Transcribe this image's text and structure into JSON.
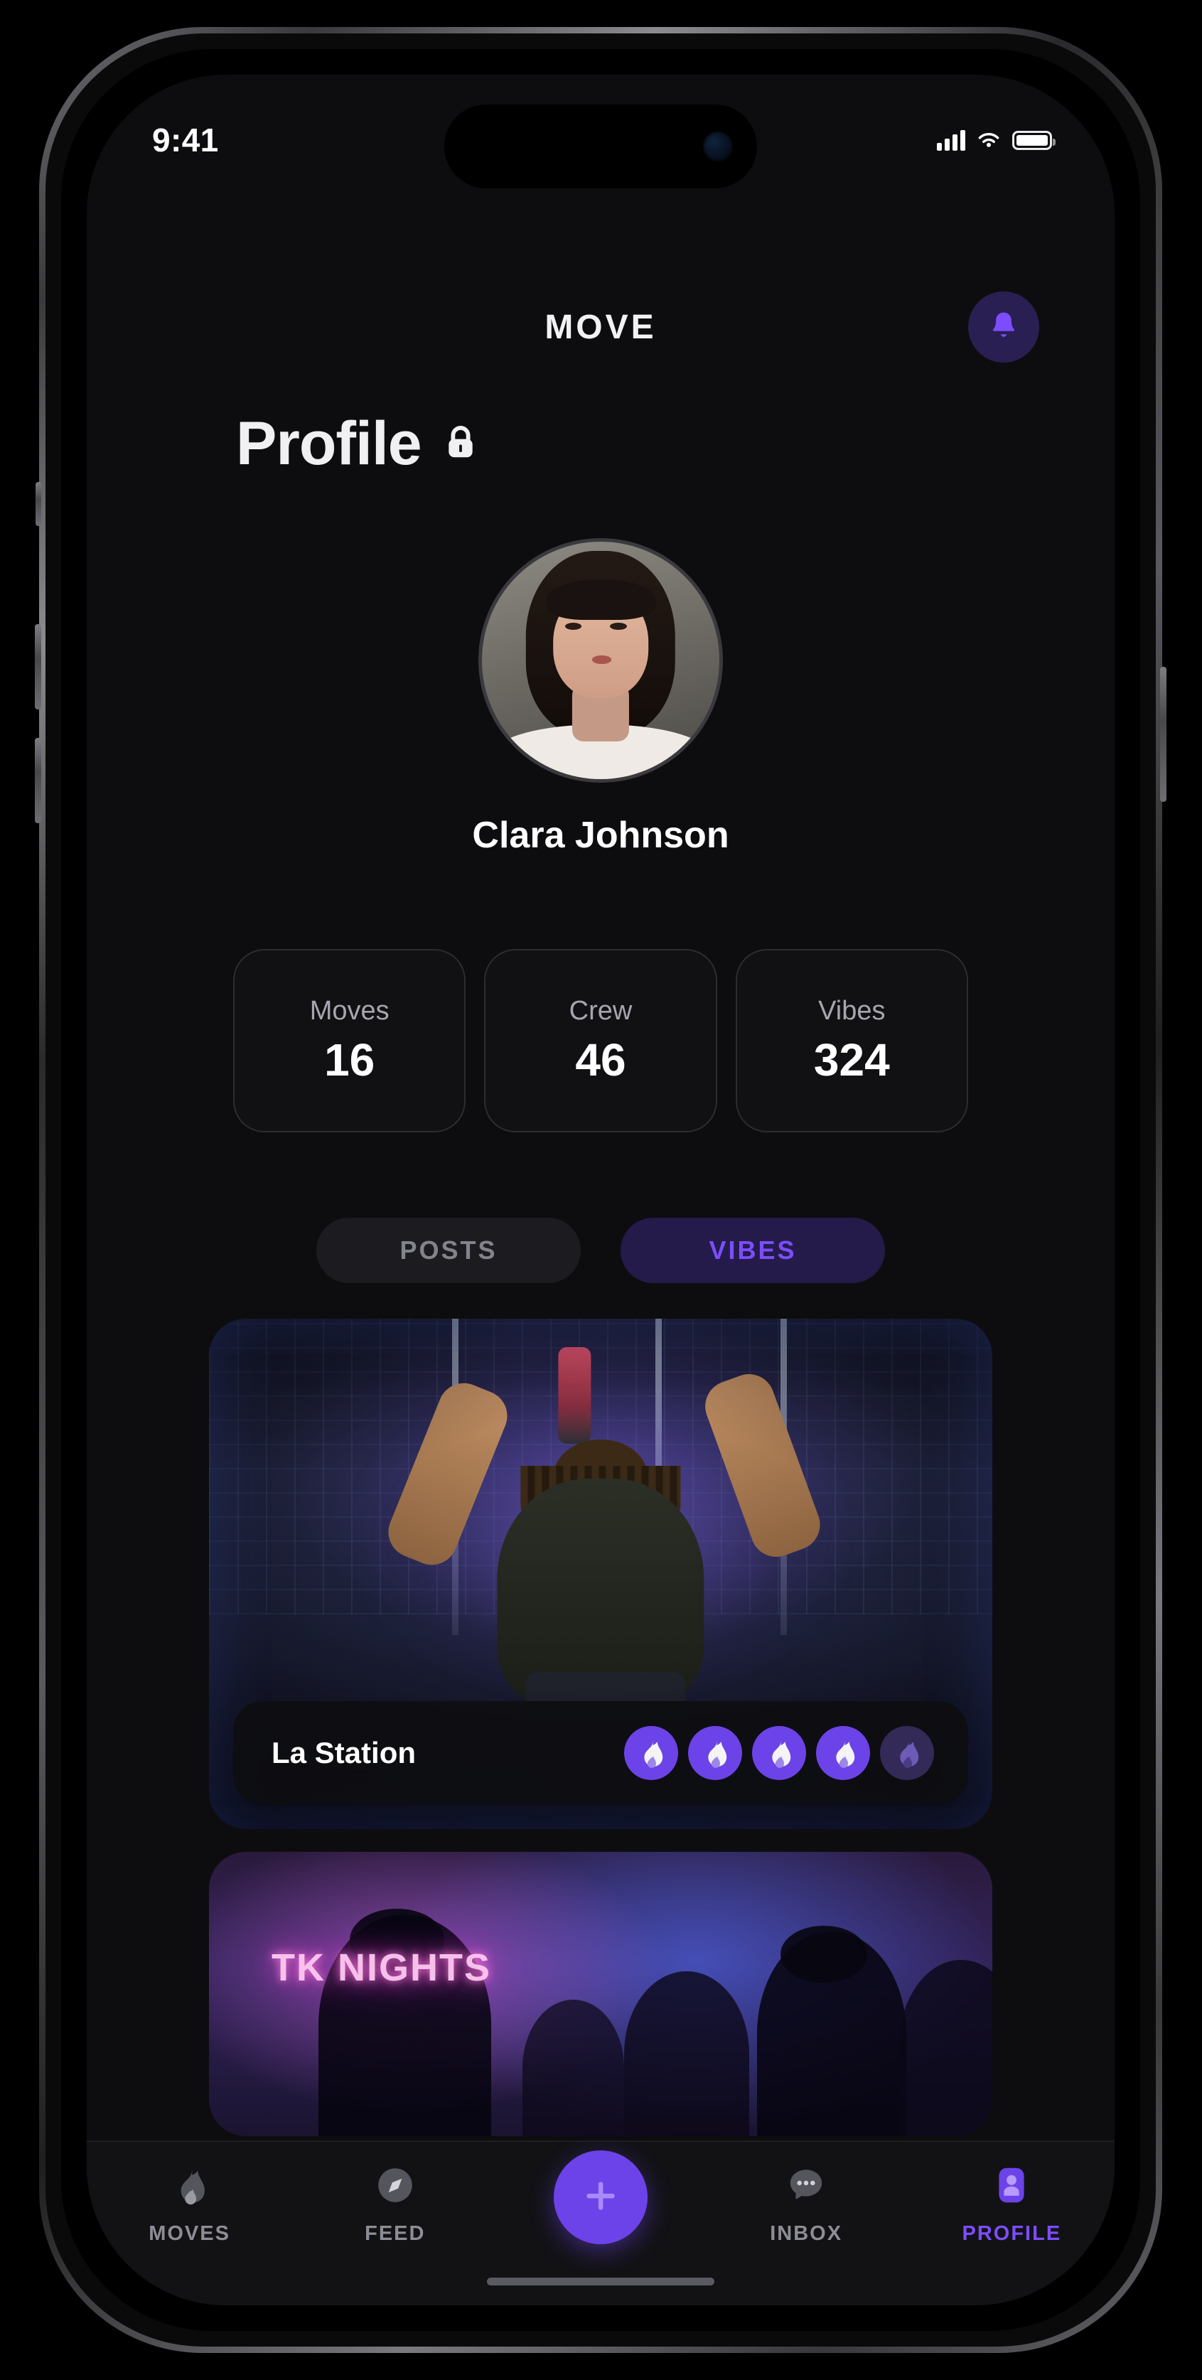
{
  "status_bar": {
    "time": "9:41",
    "signal_icon": "cellular-signal-icon",
    "wifi_icon": "wifi-icon",
    "battery_icon": "battery-full-icon"
  },
  "header": {
    "app_title": "MOVE",
    "notification_icon": "bell-icon"
  },
  "page": {
    "title": "Profile",
    "privacy_icon": "lock-closed-icon"
  },
  "profile": {
    "avatar_name": "avatar-clara-johnson",
    "name": "Clara Johnson"
  },
  "stats": [
    {
      "label": "Moves",
      "value": "16"
    },
    {
      "label": "Crew",
      "value": "46"
    },
    {
      "label": "Vibes",
      "value": "324"
    }
  ],
  "tabs": [
    {
      "label": "POSTS",
      "active": false
    },
    {
      "label": "VIBES",
      "active": true
    }
  ],
  "feed": [
    {
      "title": "La Station",
      "image_alt": "concert-performer-crowd",
      "flame_icon": "flame-icon",
      "flames_total": 5,
      "flames_filled": 4
    },
    {
      "neon_text": "TK NIGHTS",
      "image_alt": "nightclub-crowd-silhouettes"
    }
  ],
  "bottom_nav": [
    {
      "label": "MOVES",
      "icon": "flame-icon",
      "active": false
    },
    {
      "label": "FEED",
      "icon": "compass-icon",
      "active": false
    },
    {
      "label": "",
      "icon": "plus-icon",
      "active": false,
      "is_fab": true
    },
    {
      "label": "INBOX",
      "icon": "chat-bubble-icon",
      "active": false
    },
    {
      "label": "PROFILE",
      "icon": "person-icon",
      "active": true
    }
  ],
  "colors": {
    "accent": "#7c4dff",
    "accent_solid": "#6c43e8",
    "accent_dim": "#332a57",
    "background": "#0d0d0f",
    "surface": "#121215",
    "text_primary": "#ffffff",
    "text_muted": "#8d8d96"
  }
}
